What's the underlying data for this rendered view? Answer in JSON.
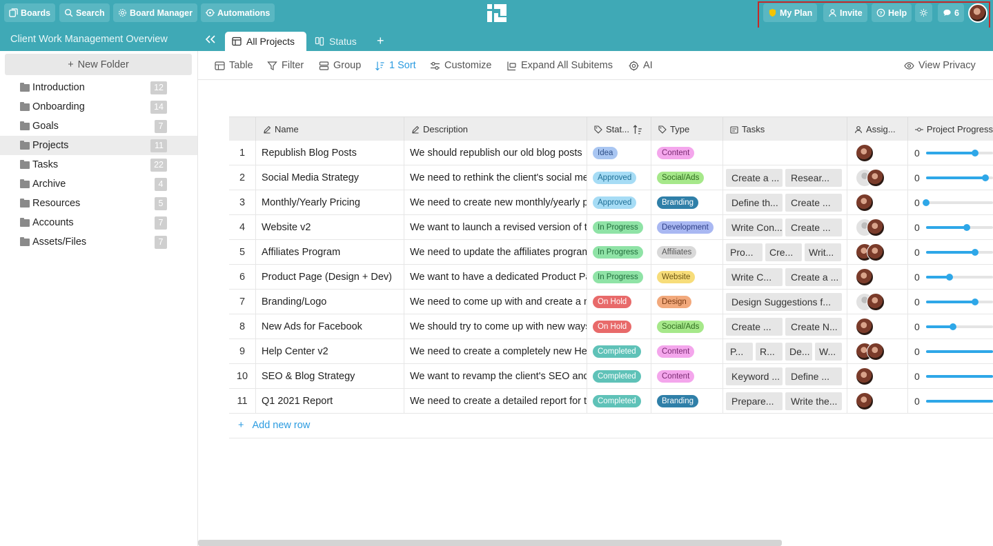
{
  "topbar": {
    "boards": "Boards",
    "search": "Search",
    "board_manager": "Board Manager",
    "automations": "Automations",
    "my_plan": "My Plan",
    "invite": "Invite",
    "help": "Help",
    "notifications_count": "6"
  },
  "subbar": {
    "workspace_title": "Client Work Management Overview",
    "tabs": [
      {
        "label": "All Projects",
        "active": true
      },
      {
        "label": "Status",
        "active": false
      }
    ],
    "add_tab": "+"
  },
  "sidebar": {
    "new_folder": "New Folder",
    "folders": [
      {
        "label": "Introduction",
        "count": "12"
      },
      {
        "label": "Onboarding",
        "count": "14"
      },
      {
        "label": "Goals",
        "count": "7"
      },
      {
        "label": "Projects",
        "count": "11",
        "selected": true
      },
      {
        "label": "Tasks",
        "count": "22"
      },
      {
        "label": "Archive",
        "count": "4"
      },
      {
        "label": "Resources",
        "count": "5"
      },
      {
        "label": "Accounts",
        "count": "7"
      },
      {
        "label": "Assets/Files",
        "count": "7"
      }
    ]
  },
  "toolbar": {
    "table": "Table",
    "filter": "Filter",
    "group": "Group",
    "sort": "1 Sort",
    "customize": "Customize",
    "expand": "Expand All Subitems",
    "ai": "AI",
    "view_privacy": "View Privacy"
  },
  "table": {
    "headers": {
      "name": "Name",
      "description": "Description",
      "status": "Stat...",
      "type": "Type",
      "tasks": "Tasks",
      "assignee": "Assig...",
      "progress": "Project Progress"
    },
    "rows": [
      {
        "num": "1",
        "name": "Republish Blog Posts",
        "desc": "We should republish our old blog posts",
        "status": "Idea",
        "type": "Content",
        "tasks": [],
        "avatars": [
          "p"
        ],
        "progress": "0",
        "fill": 0.73
      },
      {
        "num": "2",
        "name": "Social Media Strategy",
        "desc": "We need to rethink the client's social media",
        "status": "Approved",
        "type": "Social/Ads",
        "tasks": [
          "Create a ...",
          "Resear..."
        ],
        "avatars": [
          "g",
          "p"
        ],
        "progress": "0",
        "fill": 0.89
      },
      {
        "num": "3",
        "name": "Monthly/Yearly Pricing",
        "desc": "We need to create new monthly/yearly pricing",
        "status": "Approved",
        "type": "Branding",
        "tasks": [
          "Define th...",
          "Create ..."
        ],
        "avatars": [
          "p"
        ],
        "progress": "0",
        "fill": 0.0
      },
      {
        "num": "4",
        "name": "Website v2",
        "desc": "We want to launch a revised version of the",
        "status": "In Progress",
        "type": "Development",
        "tasks": [
          "Write Con...",
          "Create ..."
        ],
        "avatars": [
          "g",
          "p"
        ],
        "progress": "0",
        "fill": 0.61
      },
      {
        "num": "5",
        "name": "Affiliates Program",
        "desc": "We need to update the affiliates program",
        "status": "In Progress",
        "type": "Affiliates",
        "tasks": [
          "Pro...",
          "Cre...",
          "Writ..."
        ],
        "avatars": [
          "p",
          "p"
        ],
        "progress": "0",
        "fill": 0.73
      },
      {
        "num": "6",
        "name": "Product Page (Design + Dev)",
        "desc": "We want to have a dedicated Product Page",
        "status": "In Progress",
        "type": "Website",
        "tasks": [
          "Write C...",
          "Create a ..."
        ],
        "avatars": [
          "p"
        ],
        "progress": "0",
        "fill": 0.35
      },
      {
        "num": "7",
        "name": "Branding/Logo",
        "desc": "We need to come up with and create a new",
        "status": "On Hold",
        "type": "Design",
        "tasks": [
          "Design Suggestions f..."
        ],
        "avatars": [
          "g",
          "p"
        ],
        "progress": "0",
        "fill": 0.73
      },
      {
        "num": "8",
        "name": "New Ads for Facebook",
        "desc": "We should try to come up with new ways",
        "status": "On Hold",
        "type": "Social/Ads",
        "tasks": [
          "Create ...",
          "Create N..."
        ],
        "avatars": [
          "p"
        ],
        "progress": "0",
        "fill": 0.4
      },
      {
        "num": "9",
        "name": "Help Center v2",
        "desc": "We need to create a completely new Help",
        "status": "Completed",
        "type": "Content",
        "tasks": [
          "P...",
          "R...",
          "De...",
          "W..."
        ],
        "avatars": [
          "p",
          "p"
        ],
        "progress": "0",
        "fill": 1.0
      },
      {
        "num": "10",
        "name": "SEO & Blog Strategy",
        "desc": "We want to revamp the client's SEO and",
        "status": "Completed",
        "type": "Content",
        "tasks": [
          "Keyword ...",
          "Define ..."
        ],
        "avatars": [
          "p"
        ],
        "progress": "0",
        "fill": 1.0
      },
      {
        "num": "11",
        "name": "Q1 2021 Report",
        "desc": "We need to create a detailed report for the",
        "status": "Completed",
        "type": "Branding",
        "tasks": [
          "Prepare...",
          "Write the..."
        ],
        "avatars": [
          "p"
        ],
        "progress": "0",
        "fill": 1.0
      }
    ],
    "add_row": "Add new row"
  },
  "status_colors": {
    "Idea": {
      "bg": "#a9c6f2",
      "fg": "#2f4f86"
    },
    "Approved": {
      "bg": "#a6dcf5",
      "fg": "#1f6f96"
    },
    "In Progress": {
      "bg": "#8fe3a6",
      "fg": "#1f6b3a"
    },
    "On Hold": {
      "bg": "#e86a6a",
      "fg": "#ffffff"
    },
    "Completed": {
      "bg": "#5fc2b8",
      "fg": "#ffffff"
    }
  },
  "type_colors": {
    "Content": {
      "bg": "#f4a6ec",
      "fg": "#7a2a72"
    },
    "Social/Ads": {
      "bg": "#a6e88a",
      "fg": "#2f6b1e"
    },
    "Branding": {
      "bg": "#2f7fa8",
      "fg": "#ffffff"
    },
    "Development": {
      "bg": "#a9b8f2",
      "fg": "#2f3f86"
    },
    "Affiliates": {
      "bg": "#d9d9d9",
      "fg": "#555555"
    },
    "Website": {
      "bg": "#f7dd7a",
      "fg": "#6b5412"
    },
    "Design": {
      "bg": "#f2a97c",
      "fg": "#7a3a12"
    }
  }
}
